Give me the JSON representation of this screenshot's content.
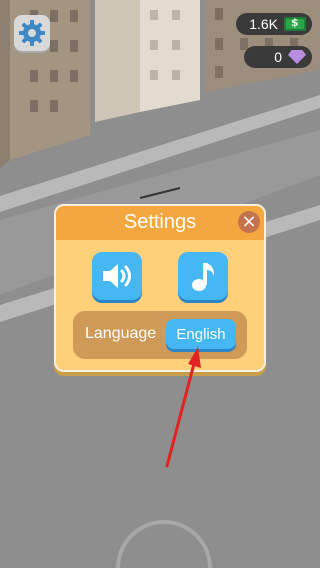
{
  "hud": {
    "settings_icon": "gear-icon",
    "cash_value": "1.6K",
    "cash_icon": "cash-icon",
    "gems_value": "0",
    "gems_icon": "gem-icon"
  },
  "dialog": {
    "title": "Settings",
    "close_icon": "close-icon",
    "sound_icon": "speaker-icon",
    "music_icon": "music-note-icon",
    "language_label": "Language",
    "language_value": "English"
  },
  "colors": {
    "dialog_body": "#ffd07a",
    "dialog_header": "#f4a73f",
    "button_blue": "#45b7f2",
    "annotation_arrow": "#e32222"
  }
}
